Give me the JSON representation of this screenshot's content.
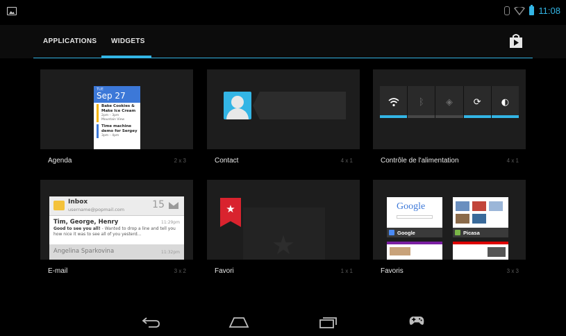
{
  "status_bar": {
    "time": "11:08",
    "accent_color": "#33b5e5",
    "icons": [
      "gallery-notification-icon",
      "bluetooth-icon",
      "wifi-icon",
      "battery-icon"
    ]
  },
  "tabs": [
    {
      "label": "APPLICATIONS",
      "selected": false
    },
    {
      "label": "WIDGETS",
      "selected": true
    }
  ],
  "toolbar": {
    "store_icon": "play-store-bag-icon"
  },
  "widgets": [
    {
      "label": "Agenda",
      "size": "2 x 3",
      "preview": {
        "dow": "TUE",
        "date": "Sep 27",
        "events": [
          {
            "title": "Bake Cookies & Make Ice Cream",
            "time": "2pm – 3pm",
            "place": "Mountain View"
          },
          {
            "title": "Time machine demo for Sergey",
            "time": "3pm – 4pm"
          }
        ]
      }
    },
    {
      "label": "Contact",
      "size": "4 x 1"
    },
    {
      "label": "Contrôle de l'alimentation",
      "size": "4 x 1",
      "preview": {
        "toggles": [
          {
            "icon": "wifi-icon",
            "on": true
          },
          {
            "icon": "bluetooth-icon",
            "on": false
          },
          {
            "icon": "gps-icon",
            "on": false
          },
          {
            "icon": "sync-icon",
            "on": true
          },
          {
            "icon": "brightness-icon",
            "on": true
          }
        ]
      }
    },
    {
      "label": "E-mail",
      "size": "3 x 2",
      "preview": {
        "folder": "Inbox",
        "account": "username@popmail.com",
        "count": "15",
        "from": "Tim, George, Henry",
        "time": "11:29pm",
        "subject": "Good to see you all!",
        "snippet": " - Wanted to drop a line and tell you how nice it was to see all of you yesterd...",
        "next_from": "Angelina Sparkovina",
        "next_time": "11:32pm"
      }
    },
    {
      "label": "Favori",
      "size": "1 x 1"
    },
    {
      "label": "Favoris",
      "size": "3 x 3",
      "preview": {
        "google_text": "Google",
        "tiles": [
          "Google",
          "Picasa"
        ]
      }
    }
  ],
  "nav_bar": {
    "icons": [
      "back-icon",
      "home-icon",
      "recent-apps-icon",
      "game-controller-icon"
    ]
  }
}
